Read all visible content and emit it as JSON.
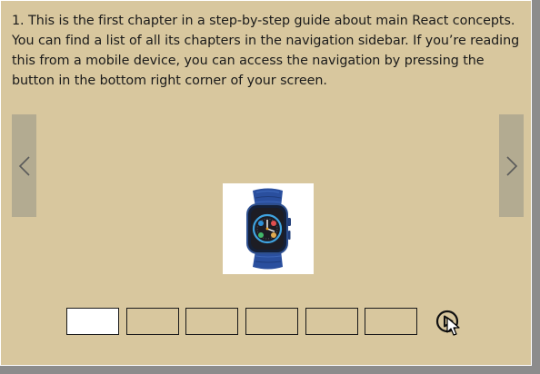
{
  "carousel": {
    "description": "1. This is the first chapter in a step-by-step guide about main React concepts. You can find a list of all its chapters in the navigation sidebar. If you’re reading this from a mobile device, you can access the navigation by pressing the button in the bottom right corner of your screen.",
    "prev_icon": "chevron-left-icon",
    "next_icon": "chevron-right-icon",
    "slide_image": "smartwatch-image",
    "thumbnail_count": 6,
    "active_thumbnail": 1,
    "play_icon": "play-circle-icon"
  },
  "colors": {
    "panel_background": "#d8c79e",
    "arrow_background": "#b3ab91",
    "watch_band": "#2a4f9e",
    "watch_screen": "#1d1d24",
    "frame_shadow": "#8c8c8c"
  }
}
